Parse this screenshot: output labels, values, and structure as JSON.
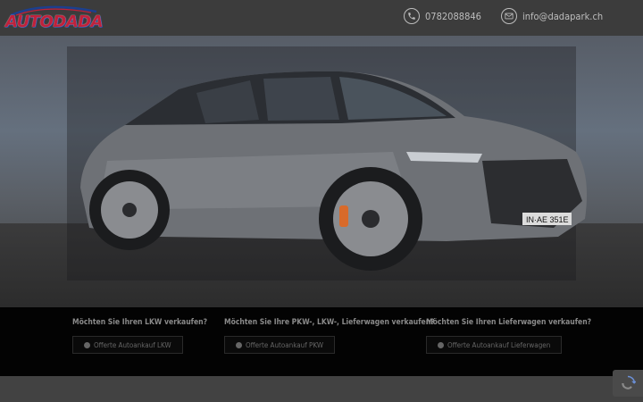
{
  "header": {
    "logo_text": "AUTODADA",
    "phone": "0782088846",
    "email": "info@dadapark.ch",
    "icons": {
      "phone": "phone-icon",
      "email": "mail-icon"
    }
  },
  "hero": {
    "image": "car-photo",
    "plate_text": "IN·AE 351E"
  },
  "offers": [
    {
      "question": "Möchten Sie Ihren LKW verkaufen?",
      "button": "Offerte Autoankauf LKW"
    },
    {
      "question": "Möchten Sie Ihre PKW-, LKW-, Lieferwagen verkaufen?",
      "button": "Offerte Autoankauf PKW"
    },
    {
      "question": "Möchten Sie Ihren Lieferwagen verkaufen?",
      "button": "Offerte Autoankauf Lieferwagen"
    }
  ],
  "colors": {
    "logo_red": "#c0213b",
    "logo_blue": "#1c3f8e",
    "header_bg": "#3c3c3c",
    "band_bg": "#030303"
  }
}
